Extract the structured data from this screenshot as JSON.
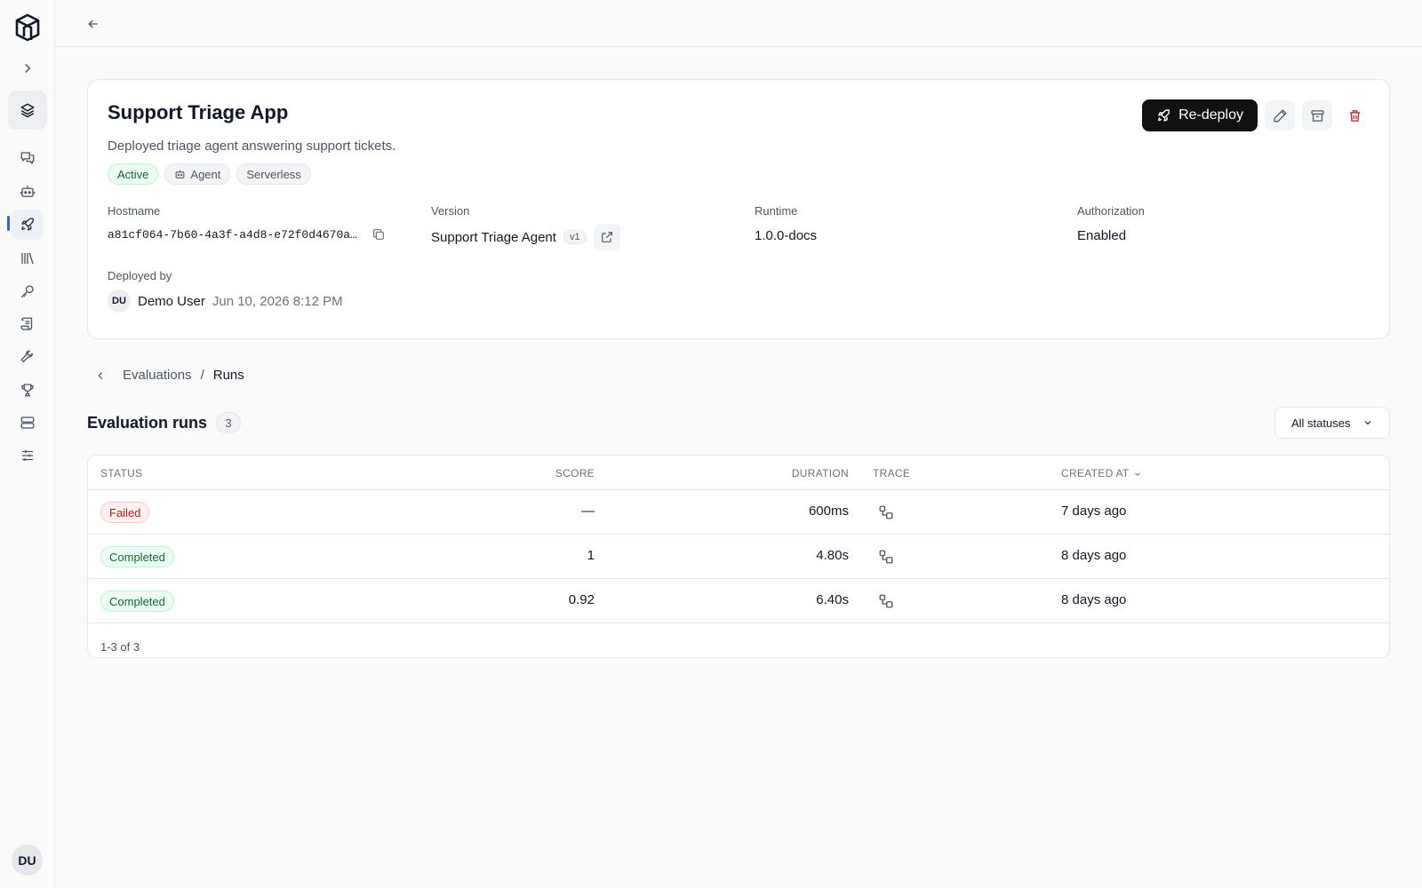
{
  "sidebar": {
    "user_initials": "DU",
    "items": [
      {
        "name": "chat-icon"
      },
      {
        "name": "agent-icon"
      },
      {
        "name": "rocket-icon",
        "active": true
      },
      {
        "name": "library-icon"
      },
      {
        "name": "key-icon"
      },
      {
        "name": "scroll-icon"
      },
      {
        "name": "wrench-icon"
      },
      {
        "name": "trophy-icon"
      },
      {
        "name": "server-icon"
      },
      {
        "name": "sliders-icon"
      }
    ]
  },
  "app": {
    "title": "Support Triage App",
    "description": "Deployed triage agent answering support tickets.",
    "tags": [
      "Active",
      "Agent",
      "Serverless"
    ],
    "redeploy_label": "Re-deploy",
    "hostname_label": "Hostname",
    "hostname": "a81cf064-7b60-4a3f-a4d8-e72f0d4670a…",
    "version_label": "Version",
    "version_name": "Support Triage Agent",
    "version_badge": "v1",
    "runtime_label": "Runtime",
    "runtime": "1.0.0-docs",
    "auth_label": "Authorization",
    "auth": "Enabled",
    "deployed_by_label": "Deployed by",
    "deployed_by_initials": "DU",
    "deployed_by": "Demo User",
    "deployed_at": "Jun 10, 2026 8:12 PM"
  },
  "breadcrumb": {
    "parent": "Evaluations",
    "separator": "/",
    "current": "Runs"
  },
  "runs": {
    "title": "Evaluation runs",
    "count": "3",
    "filter_label": "All statuses",
    "columns": {
      "status": "STATUS",
      "score": "SCORE",
      "duration": "DURATION",
      "trace": "TRACE",
      "created": "CREATED AT"
    },
    "rows": [
      {
        "status": "Failed",
        "kind": "failed",
        "score": "—",
        "duration": "600ms",
        "created": "7 days ago"
      },
      {
        "status": "Completed",
        "kind": "done",
        "score": "1",
        "duration": "4.80s",
        "created": "8 days ago"
      },
      {
        "status": "Completed",
        "kind": "done",
        "score": "0.92",
        "duration": "6.40s",
        "created": "8 days ago"
      }
    ],
    "footer": "1-3 of 3"
  },
  "colors": {
    "accent": "#2563eb",
    "primary_button": "#111111",
    "success": "#166534",
    "danger": "#b91c1c"
  }
}
